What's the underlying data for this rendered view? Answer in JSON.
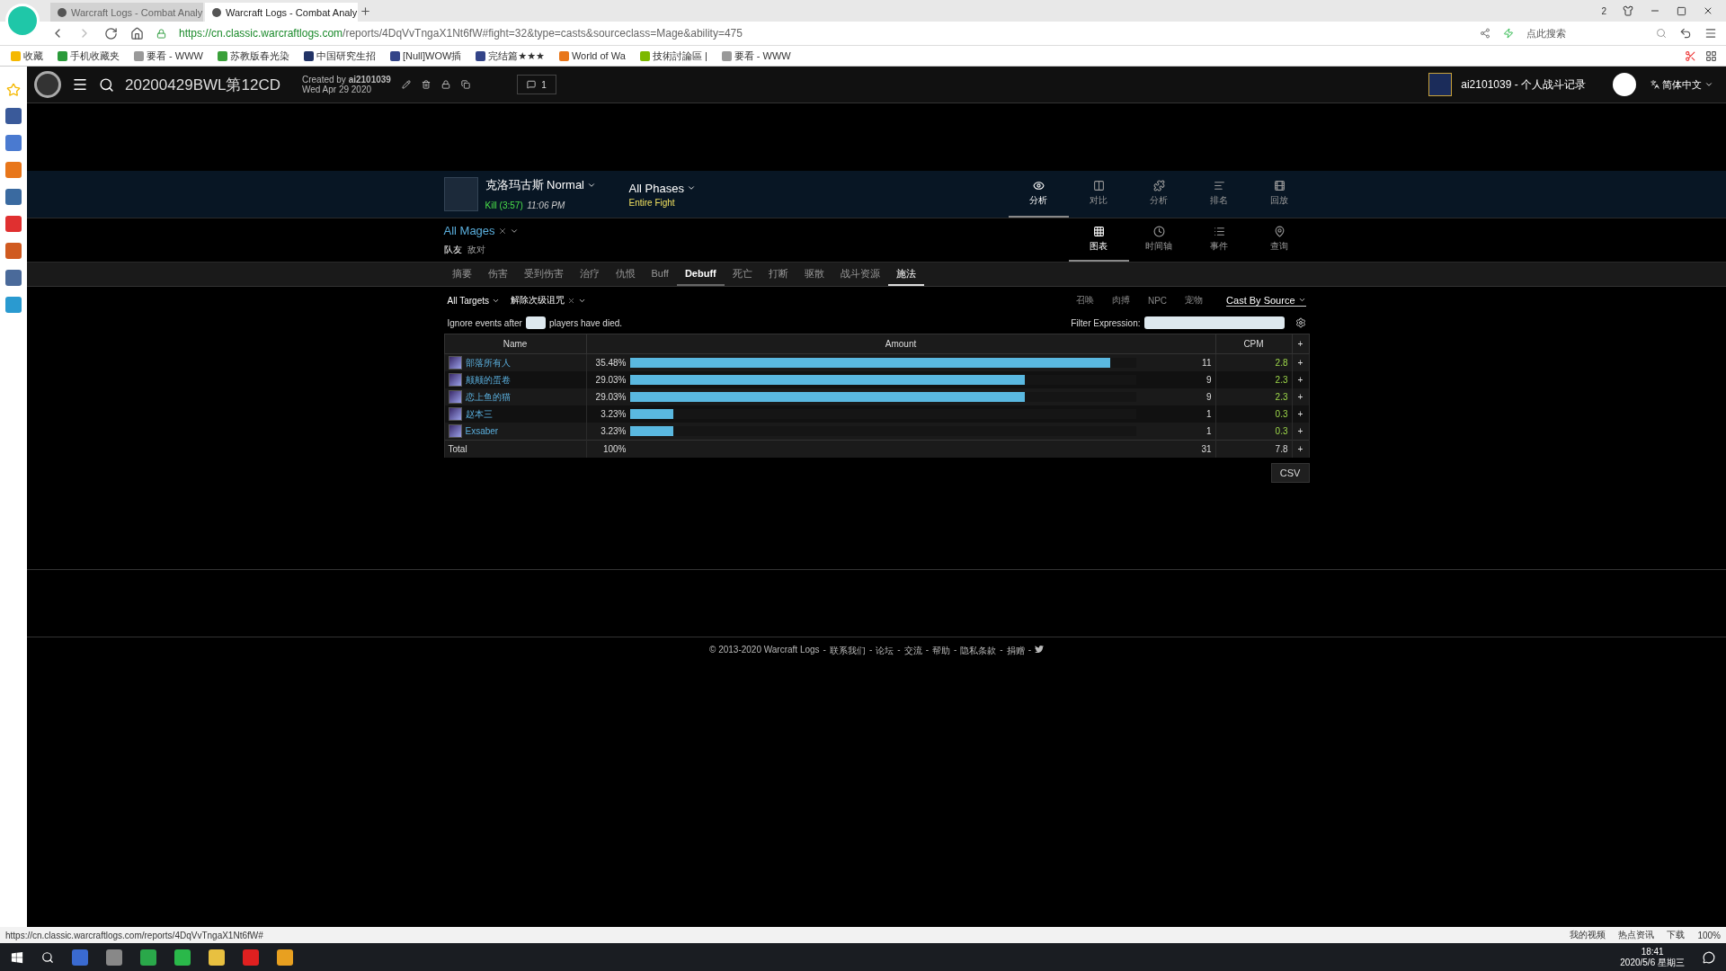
{
  "browser": {
    "tabs": [
      {
        "title": "Warcraft Logs - Combat Analy",
        "selected": false
      },
      {
        "title": "Warcraft Logs - Combat Analy",
        "selected": true
      }
    ],
    "url_host": "https://cn.classic.warcraftlogs.com",
    "url_path": "/reports/4DqVvTngaX1Nt6fW#fight=32&type=casts&sourceclass=Mage&ability=475",
    "search_placeholder": "点此搜索",
    "window_badge": "2",
    "bookmarks": [
      "收藏",
      "手机收藏夹",
      "要看 - WWW",
      "苏教版春光染",
      "中国研究生招",
      "[Null]WOW插",
      "完结篇★★★",
      "World of Wa",
      "技術討論區 |",
      "要看 - WWW"
    ],
    "status_url": "https://cn.classic.warcraftlogs.com/reports/4DqVvTngaX1Nt6fW#",
    "status_items": [
      "我的视频",
      "热点资讯",
      "下载",
      "100%"
    ]
  },
  "site_header": {
    "report_title": "20200429BWL第12CD",
    "created_label": "Created by",
    "creator": "ai2101039",
    "created_date": "Wed Apr 29 2020",
    "comment_count": "1",
    "account": "ai2101039 - 个人战斗记录",
    "language": "简体中文"
  },
  "fight": {
    "boss": "克洛玛古斯 Normal",
    "result": "Kill (3:57)",
    "time": "11:06 PM",
    "phases": "All Phases",
    "phase_detail": "Entire Fight",
    "nav": [
      {
        "label": "分析",
        "selected": true
      },
      {
        "label": "对比",
        "selected": false
      },
      {
        "label": "分析",
        "selected": false
      },
      {
        "label": "排名",
        "selected": false
      },
      {
        "label": "回放",
        "selected": false
      }
    ]
  },
  "source": {
    "name": "All Mages",
    "sides": [
      {
        "label": "队友",
        "selected": true
      },
      {
        "label": "敌对",
        "selected": false
      }
    ],
    "views": [
      {
        "label": "图表",
        "selected": true
      },
      {
        "label": "时间轴",
        "selected": false
      },
      {
        "label": "事件",
        "selected": false
      },
      {
        "label": "查询",
        "selected": false
      }
    ]
  },
  "tabs": [
    {
      "label": "摘要",
      "selected": false,
      "hover": false
    },
    {
      "label": "伤害",
      "selected": false,
      "hover": false
    },
    {
      "label": "受到伤害",
      "selected": false,
      "hover": false
    },
    {
      "label": "治疗",
      "selected": false,
      "hover": false
    },
    {
      "label": "仇恨",
      "selected": false,
      "hover": false
    },
    {
      "label": "Buff",
      "selected": false,
      "hover": false
    },
    {
      "label": "Debuff",
      "selected": false,
      "hover": true
    },
    {
      "label": "死亡",
      "selected": false,
      "hover": false
    },
    {
      "label": "打断",
      "selected": false,
      "hover": false
    },
    {
      "label": "驱散",
      "selected": false,
      "hover": false
    },
    {
      "label": "战斗资源",
      "selected": false,
      "hover": false
    },
    {
      "label": "施法",
      "selected": true,
      "hover": false
    }
  ],
  "filters": {
    "targets": "All Targets",
    "ability": "解除次级诅咒",
    "options": [
      "召唤",
      "肉搏",
      "NPC",
      "宠物"
    ],
    "cast_by": "Cast By Source",
    "ignore_before": "Ignore events after",
    "ignore_after": "players have died.",
    "filter_label": "Filter Expression:"
  },
  "table": {
    "columns": [
      "Name",
      "Amount",
      "CPM",
      "+"
    ],
    "rows": [
      {
        "name": "部落所有人",
        "percent": "35.48%",
        "level": 0.95,
        "count": "11",
        "cpm": "2.8",
        "add": "+"
      },
      {
        "name": "颠颠的蛋卷",
        "percent": "29.03%",
        "level": 0.78,
        "count": "9",
        "cpm": "2.3",
        "add": "+"
      },
      {
        "name": "恋上鱼的猫",
        "percent": "29.03%",
        "level": 0.78,
        "count": "9",
        "cpm": "2.3",
        "add": "+"
      },
      {
        "name": "赵本三",
        "percent": "3.23%",
        "level": 0.086,
        "count": "1",
        "cpm": "0.3",
        "add": "+"
      },
      {
        "name": "Exsaber",
        "percent": "3.23%",
        "level": 0.086,
        "count": "1",
        "cpm": "0.3",
        "add": "+"
      }
    ],
    "total": {
      "name": "Total",
      "percent": "100%",
      "count": "31",
      "cpm": "7.8",
      "add": "+"
    }
  },
  "csv": "CSV",
  "footer": {
    "copyright": "© 2013-2020 Warcraft Logs",
    "separator": "-",
    "links": [
      "联系我们",
      "论坛",
      "交流",
      "帮助",
      "隐私条款",
      "捐赠"
    ]
  },
  "taskbar": {
    "time": "18:41",
    "date": "2020/5/6 星期三"
  }
}
